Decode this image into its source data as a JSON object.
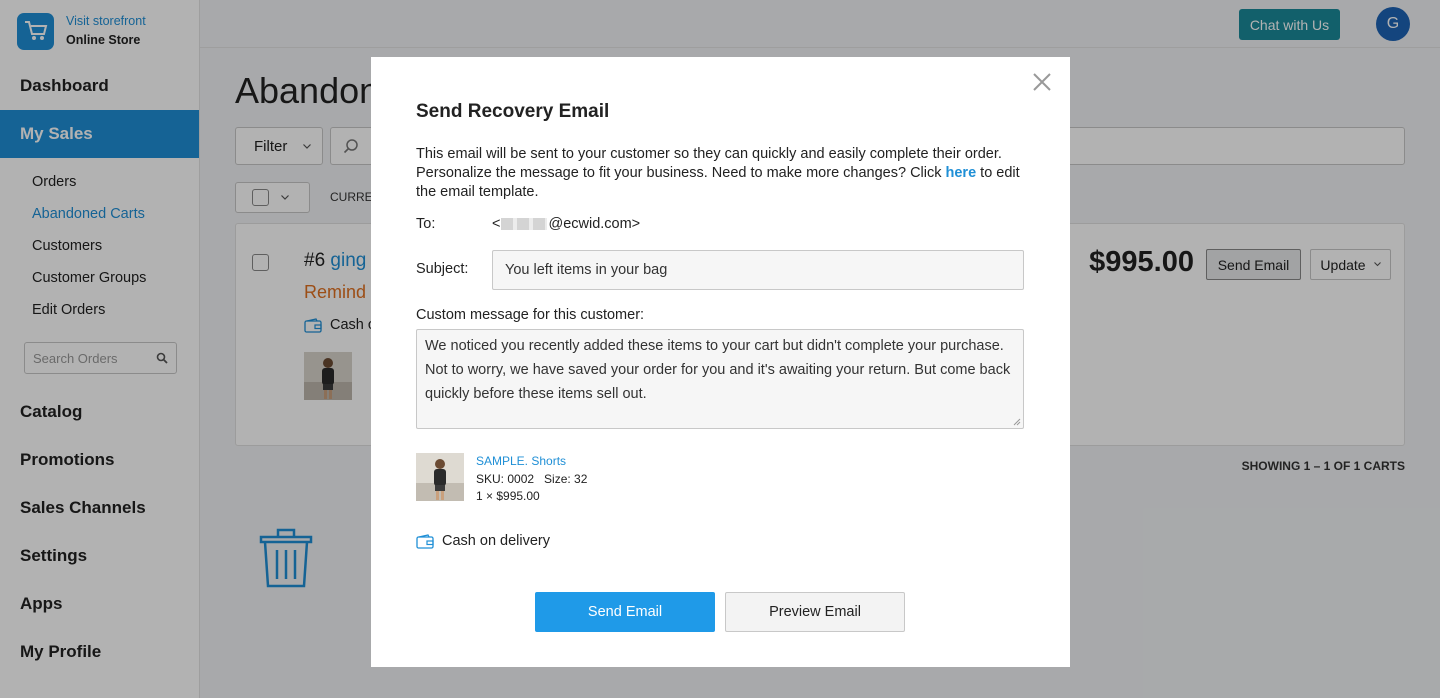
{
  "brand": {
    "link": "Visit storefront",
    "name": "Online Store"
  },
  "sidebar": {
    "top_items": [
      {
        "label": "Dashboard"
      },
      {
        "label": "My Sales"
      }
    ],
    "sub_items": [
      {
        "label": "Orders"
      },
      {
        "label": "Abandoned Carts"
      },
      {
        "label": "Customers"
      },
      {
        "label": "Customer Groups"
      },
      {
        "label": "Edit Orders"
      }
    ],
    "search_placeholder": "Search Orders",
    "bottom_items": [
      {
        "label": "Catalog"
      },
      {
        "label": "Promotions"
      },
      {
        "label": "Sales Channels"
      },
      {
        "label": "Settings"
      },
      {
        "label": "Apps"
      },
      {
        "label": "My Profile"
      }
    ]
  },
  "header": {
    "chat_label": "Chat with Us",
    "avatar_initial": "G"
  },
  "page": {
    "title": "Abandon",
    "filter_label": "Filter",
    "current_label": "CURRE",
    "order_number": "#6",
    "order_name": "ging",
    "reminder": "Remind",
    "payment": "Cash o",
    "price": "$995.00",
    "send_email": "Send Email",
    "update": "Update",
    "showing": "SHOWING 1 – 1 OF 1 CARTS"
  },
  "modal": {
    "title": "Send Recovery Email",
    "desc_before": "This email will be sent to your customer so they can quickly and easily complete their order. Personalize the message to fit your business. Need to make more changes? Click ",
    "desc_link": "here",
    "desc_after": " to edit the email template.",
    "to_label": "To:",
    "to_prefix": "<",
    "to_suffix": "@ecwid.com>",
    "subject_label": "Subject:",
    "subject_value": "You left items in your bag",
    "message_label": "Custom message for this customer:",
    "message_value": "We noticed you recently added these items to your cart but didn't complete your purchase. Not to worry, we have saved your order for you and it's awaiting your return. But come back quickly before these items sell out.",
    "product": {
      "name": "SAMPLE. Shorts",
      "sku": "SKU: 0002   Size: 32",
      "qty_price": "1 × $995.00"
    },
    "payment": "Cash on delivery",
    "send_button": "Send Email",
    "preview_button": "Preview Email"
  },
  "colors": {
    "accent": "#1f8fd6",
    "primary_button": "#1f9ae8",
    "chat": "#1a8a9a",
    "reminder": "#e07020"
  }
}
